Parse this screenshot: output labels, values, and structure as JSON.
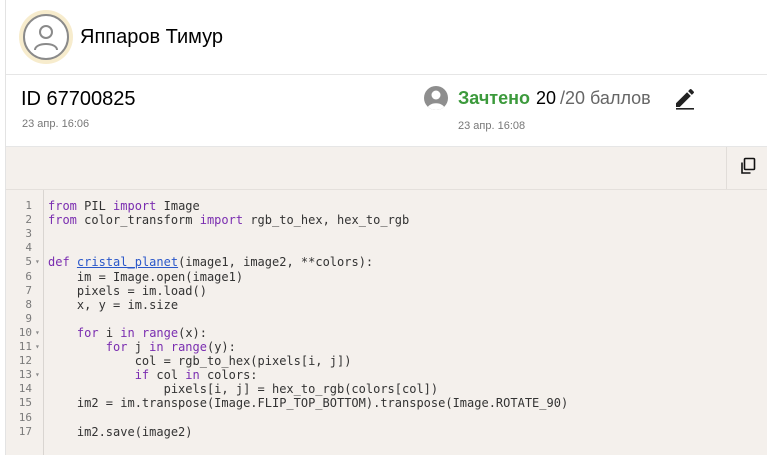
{
  "user": {
    "name": "Яппаров Тимур"
  },
  "submission": {
    "id": "ID 67700825",
    "date": "23 апр. 16:06"
  },
  "review": {
    "verdict": "Зачтено",
    "score": "20",
    "max": "/20 баллов",
    "date": "23 апр. 16:08"
  },
  "colors": {
    "verdict": "#3c9a3c",
    "keyword": "#7a2db0",
    "function_name": "#2a57c9",
    "code_bg": "#f4f0ec"
  },
  "icons": {
    "copy": "copy-icon",
    "edit": "pencil-icon",
    "avatar": "user-icon"
  },
  "code": {
    "language": "python",
    "lines": [
      {
        "n": "1",
        "fold": false,
        "parts": [
          [
            "kw",
            "from"
          ],
          [
            "t",
            " PIL "
          ],
          [
            "kw",
            "import"
          ],
          [
            "t",
            " Image"
          ]
        ]
      },
      {
        "n": "2",
        "fold": false,
        "parts": [
          [
            "kw",
            "from"
          ],
          [
            "t",
            " color_transform "
          ],
          [
            "kw",
            "import"
          ],
          [
            "t",
            " rgb_to_hex, hex_to_rgb"
          ]
        ]
      },
      {
        "n": "3",
        "fold": false,
        "parts": []
      },
      {
        "n": "4",
        "fold": false,
        "parts": []
      },
      {
        "n": "5",
        "fold": true,
        "parts": [
          [
            "kw",
            "def"
          ],
          [
            "t",
            " "
          ],
          [
            "fn",
            "cristal_planet"
          ],
          [
            "t",
            "(image1, image2, **colors):"
          ]
        ]
      },
      {
        "n": "6",
        "fold": false,
        "parts": [
          [
            "t",
            "    im = Image.open(image1)"
          ]
        ]
      },
      {
        "n": "7",
        "fold": false,
        "parts": [
          [
            "t",
            "    pixels = im.load()"
          ]
        ]
      },
      {
        "n": "8",
        "fold": false,
        "parts": [
          [
            "t",
            "    x, y = im.size"
          ]
        ]
      },
      {
        "n": "9",
        "fold": false,
        "parts": []
      },
      {
        "n": "10",
        "fold": true,
        "parts": [
          [
            "t",
            "    "
          ],
          [
            "kw",
            "for"
          ],
          [
            "t",
            " i "
          ],
          [
            "kw",
            "in"
          ],
          [
            "t",
            " "
          ],
          [
            "kw",
            "range"
          ],
          [
            "t",
            "(x):"
          ]
        ]
      },
      {
        "n": "11",
        "fold": true,
        "parts": [
          [
            "t",
            "        "
          ],
          [
            "kw",
            "for"
          ],
          [
            "t",
            " j "
          ],
          [
            "kw",
            "in"
          ],
          [
            "t",
            " "
          ],
          [
            "kw",
            "range"
          ],
          [
            "t",
            "(y):"
          ]
        ]
      },
      {
        "n": "12",
        "fold": false,
        "parts": [
          [
            "t",
            "            col = rgb_to_hex(pixels[i, j])"
          ]
        ]
      },
      {
        "n": "13",
        "fold": true,
        "parts": [
          [
            "t",
            "            "
          ],
          [
            "kw",
            "if"
          ],
          [
            "t",
            " col "
          ],
          [
            "kw",
            "in"
          ],
          [
            "t",
            " colors:"
          ]
        ]
      },
      {
        "n": "14",
        "fold": false,
        "parts": [
          [
            "t",
            "                pixels[i, j] = hex_to_rgb(colors[col])"
          ]
        ]
      },
      {
        "n": "15",
        "fold": false,
        "parts": [
          [
            "t",
            "    im2 = im.transpose(Image.FLIP_TOP_BOTTOM).transpose(Image.ROTATE_90)"
          ]
        ]
      },
      {
        "n": "16",
        "fold": false,
        "parts": []
      },
      {
        "n": "17",
        "fold": false,
        "parts": [
          [
            "t",
            "    im2.save(image2)"
          ]
        ]
      }
    ]
  }
}
